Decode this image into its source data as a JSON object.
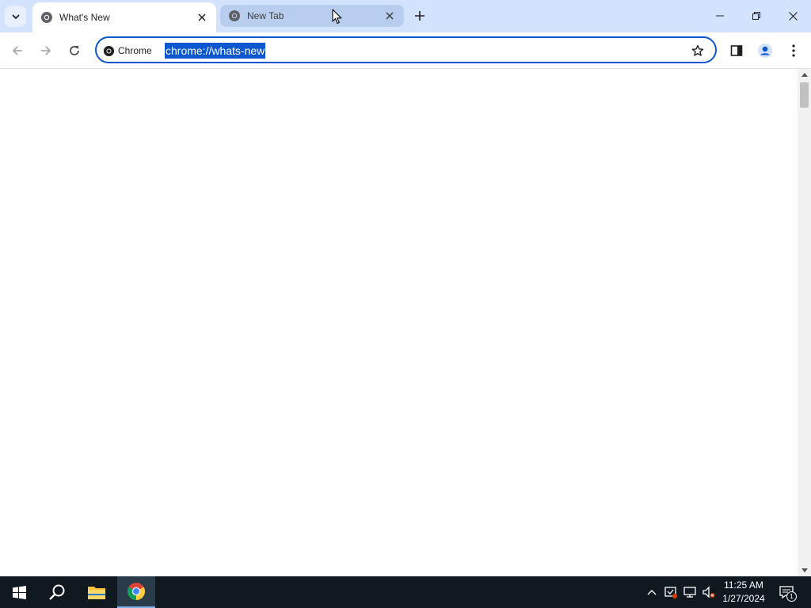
{
  "browser": {
    "tabs": [
      {
        "title": "What's New",
        "active": true
      },
      {
        "title": "New Tab",
        "active": false
      }
    ],
    "omnibox": {
      "chip_label": "Chrome",
      "url": "chrome://whats-new"
    }
  },
  "taskbar": {
    "time": "11:25 AM",
    "date": "1/27/2024",
    "notification_count": "1"
  },
  "colors": {
    "tabstrip": "#d3e3fd",
    "accent": "#0b57d0",
    "taskbar": "#101820"
  }
}
